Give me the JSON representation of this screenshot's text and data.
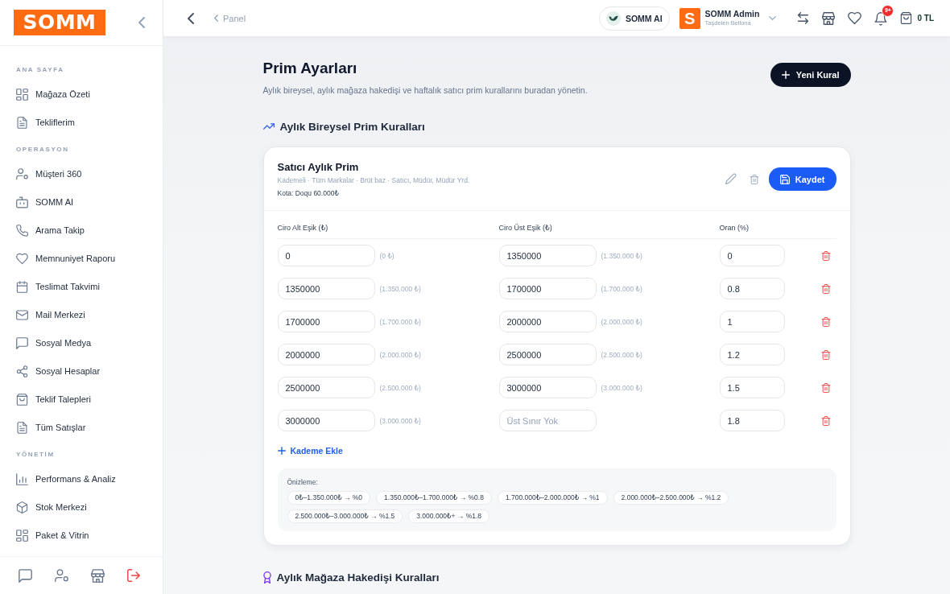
{
  "sidebar": {
    "logo": "SOMM",
    "sections": [
      {
        "title": "ANA SAYFA",
        "items": [
          {
            "label": "Mağaza Özeti",
            "selected": false
          },
          {
            "label": "Tekliflerim",
            "selected": false
          }
        ]
      },
      {
        "title": "OPERASYON",
        "items": [
          {
            "label": "Müşteri 360",
            "selected": false
          },
          {
            "label": "SOMM AI",
            "selected": false
          },
          {
            "label": "Arama Takip",
            "selected": false
          },
          {
            "label": "Memnuniyet Raporu",
            "selected": false
          },
          {
            "label": "Teslimat Takvimi",
            "selected": false
          },
          {
            "label": "Mail Merkezi",
            "selected": false
          },
          {
            "label": "Sosyal Medya",
            "selected": false
          },
          {
            "label": "Sosyal Hesaplar",
            "selected": false
          },
          {
            "label": "Teklif Talepleri",
            "selected": false
          },
          {
            "label": "Tüm Satışlar",
            "selected": false
          }
        ]
      },
      {
        "title": "YÖNETİM",
        "items": [
          {
            "label": "Performans & Analiz",
            "selected": false
          },
          {
            "label": "Stok Merkezi",
            "selected": false
          },
          {
            "label": "Paket & Vitrin",
            "selected": false
          }
        ]
      }
    ]
  },
  "topbar": {
    "breadcrumb": "Panel",
    "ai_button": "SOMM AI",
    "user": {
      "avatar": "S",
      "name": "SOMM Admin",
      "store": "Taşdelen Bellona"
    },
    "notifications": "9+",
    "cart_total": "0 TL"
  },
  "page": {
    "title": "Prim Ayarları",
    "subtitle": "Aylık bireysel, aylık mağaza hakedişi ve haftalık satıcı prim kurallarını buradan yönetin.",
    "new_button": "Yeni Kural"
  },
  "sections": [
    {
      "title": "Aylık Bireysel Prim Kuralları",
      "rules": [
        {
          "title": "Satıcı Aylık Prim",
          "meta": "Kademeli · Tüm Markalar · Brüt baz · Satıcı, Müdür, Müdür Yrd.",
          "quota": "Kota: Doqu 60.000₺",
          "save_button": "Kaydet",
          "columns": [
            "Ciro Alt Eşik (₺)",
            "Ciro Üst Eşik (₺)",
            "Oran (%)"
          ],
          "tiers": [
            {
              "lower": "0",
              "lower_note": "(0 ₺)",
              "upper": "1350000",
              "upper_note": "(1.350.000 ₺)",
              "rate": "0"
            },
            {
              "lower": "1350000",
              "lower_note": "(1.350.000 ₺)",
              "upper": "1700000",
              "upper_note": "(1.700.000 ₺)",
              "rate": "0.8"
            },
            {
              "lower": "1700000",
              "lower_note": "(1.700.000 ₺)",
              "upper": "2000000",
              "upper_note": "(2.000.000 ₺)",
              "rate": "1"
            },
            {
              "lower": "2000000",
              "lower_note": "(2.000.000 ₺)",
              "upper": "2500000",
              "upper_note": "(2.500.000 ₺)",
              "rate": "1.2"
            },
            {
              "lower": "2500000",
              "lower_note": "(2.500.000 ₺)",
              "upper": "3000000",
              "upper_note": "(3.000.000 ₺)",
              "rate": "1.5"
            },
            {
              "lower": "3000000",
              "lower_note": "(3.000.000 ₺)",
              "upper_placeholder": "Üst Sınır Yok",
              "rate": "1.8"
            }
          ],
          "add_tier": "Kademe Ekle",
          "preview": {
            "label": "Önizleme:",
            "chips": [
              "0₺–1.350.000₺ → %0",
              "1.350.000₺–1.700.000₺ → %0.8",
              "1.700.000₺–2.000.000₺ → %1",
              "2.000.000₺–2.500.000₺ → %1.2",
              "2.500.000₺–3.000.000₺ → %1.5",
              "3.000.000₺+ → %1.8"
            ]
          }
        }
      ]
    },
    {
      "title": "Aylık Mağaza Hakedişi Kuralları"
    }
  ]
}
